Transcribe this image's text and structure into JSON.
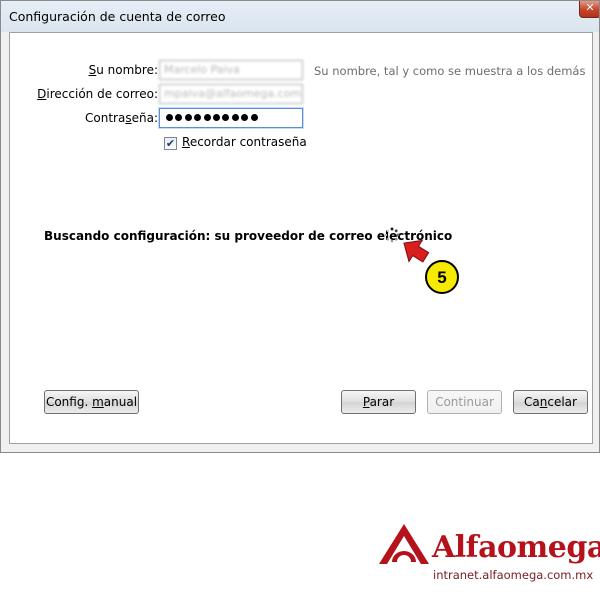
{
  "window": {
    "title": "Configuración de cuenta de correo"
  },
  "form": {
    "name_label": "Su nombre:",
    "name_value": "Marcelo Paiva",
    "name_hint": "Su nombre, tal y como se muestra a los demás",
    "email_label": "Dirección de correo:",
    "email_value": "mpaiva@alfaomega.com.mx",
    "password_label": "Contraseña:",
    "password_masked_length": 10,
    "remember_label": "Recordar contraseña",
    "remember_checked": true
  },
  "status": {
    "text": "Buscando configuración: su proveedor de correo electrónico"
  },
  "buttons": {
    "manual": "Config. manual",
    "stop": "Parar",
    "continue": "Continuar",
    "cancel": "Cancelar"
  },
  "callout": {
    "number": "5",
    "badge_color": "#f5ea00",
    "arrow_color": "#d81e1e"
  },
  "branding": {
    "name": "Alfaomega",
    "url": "intranet.alfaomega.com.mx",
    "brand_color": "#b5121b"
  }
}
